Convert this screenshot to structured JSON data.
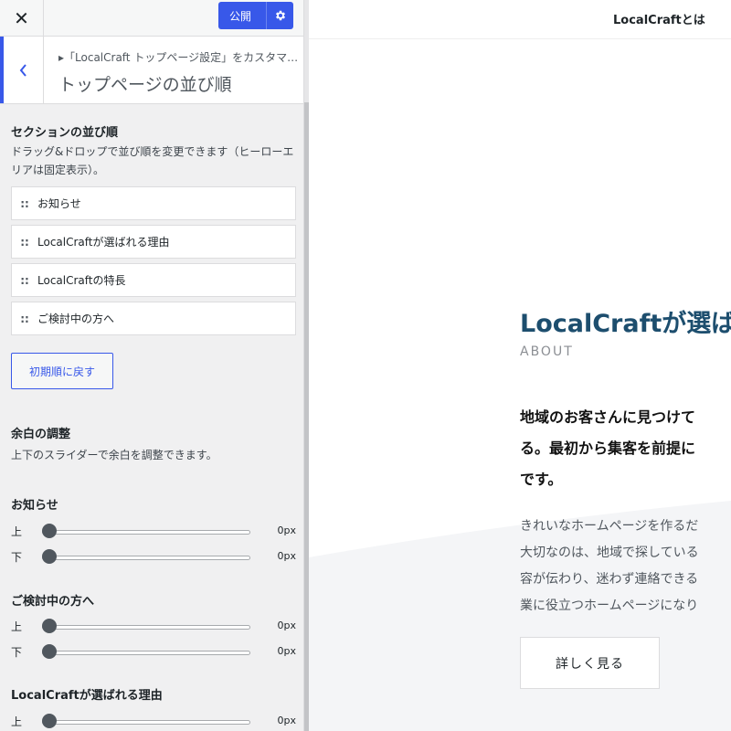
{
  "topbar": {
    "close_icon": "close-icon",
    "publish_label": "公開",
    "gear_icon": "gear-icon"
  },
  "section": {
    "breadcrumb": "▸「LocalCraft トップページ設定」をカスタマイズ中",
    "title": "トップページの並び順"
  },
  "order": {
    "heading": "セクションの並び順",
    "description": "ドラッグ&ドロップで並び順を変更できます（ヒーローエリアは固定表示）。",
    "drag_icon": "::",
    "items": [
      {
        "label": "お知らせ"
      },
      {
        "label": "LocalCraftが選ばれる理由"
      },
      {
        "label": "LocalCraftの特長"
      },
      {
        "label": "ご検討中の方へ"
      }
    ],
    "reset_label": "初期順に戻す"
  },
  "spacing": {
    "heading": "余白の調整",
    "description": "上下のスライダーで余白を調整できます。",
    "groups": [
      {
        "name": "お知らせ",
        "sliders": [
          {
            "label": "上",
            "value": "0px",
            "level": 0
          },
          {
            "label": "下",
            "value": "0px",
            "level": 0
          }
        ]
      },
      {
        "name": "ご検討中の方へ",
        "sliders": [
          {
            "label": "上",
            "value": "0px",
            "level": 0
          },
          {
            "label": "下",
            "value": "0px",
            "level": 0
          }
        ]
      },
      {
        "name": "LocalCraftが選ばれる理由",
        "sliders": [
          {
            "label": "上",
            "value": "0px",
            "level": 0
          }
        ]
      }
    ]
  },
  "preview": {
    "nav_link": "LocalCraftとは",
    "about_title": "LocalCraftが選ば",
    "about_sub": "ABOUT",
    "lead_lines": [
      "地域のお客さんに見つけて",
      "る。最初から集客を前提に",
      "です。"
    ],
    "body_lines": [
      "きれいなホームページを作るだ",
      "大切なのは、地域で探している",
      "容が伝わり、迷わず連絡できる",
      "業に役立つホームページになり"
    ],
    "more_label": "詳しく見る"
  },
  "colors": {
    "accent": "#3858e9",
    "heading_blue": "#1d4e6e"
  }
}
